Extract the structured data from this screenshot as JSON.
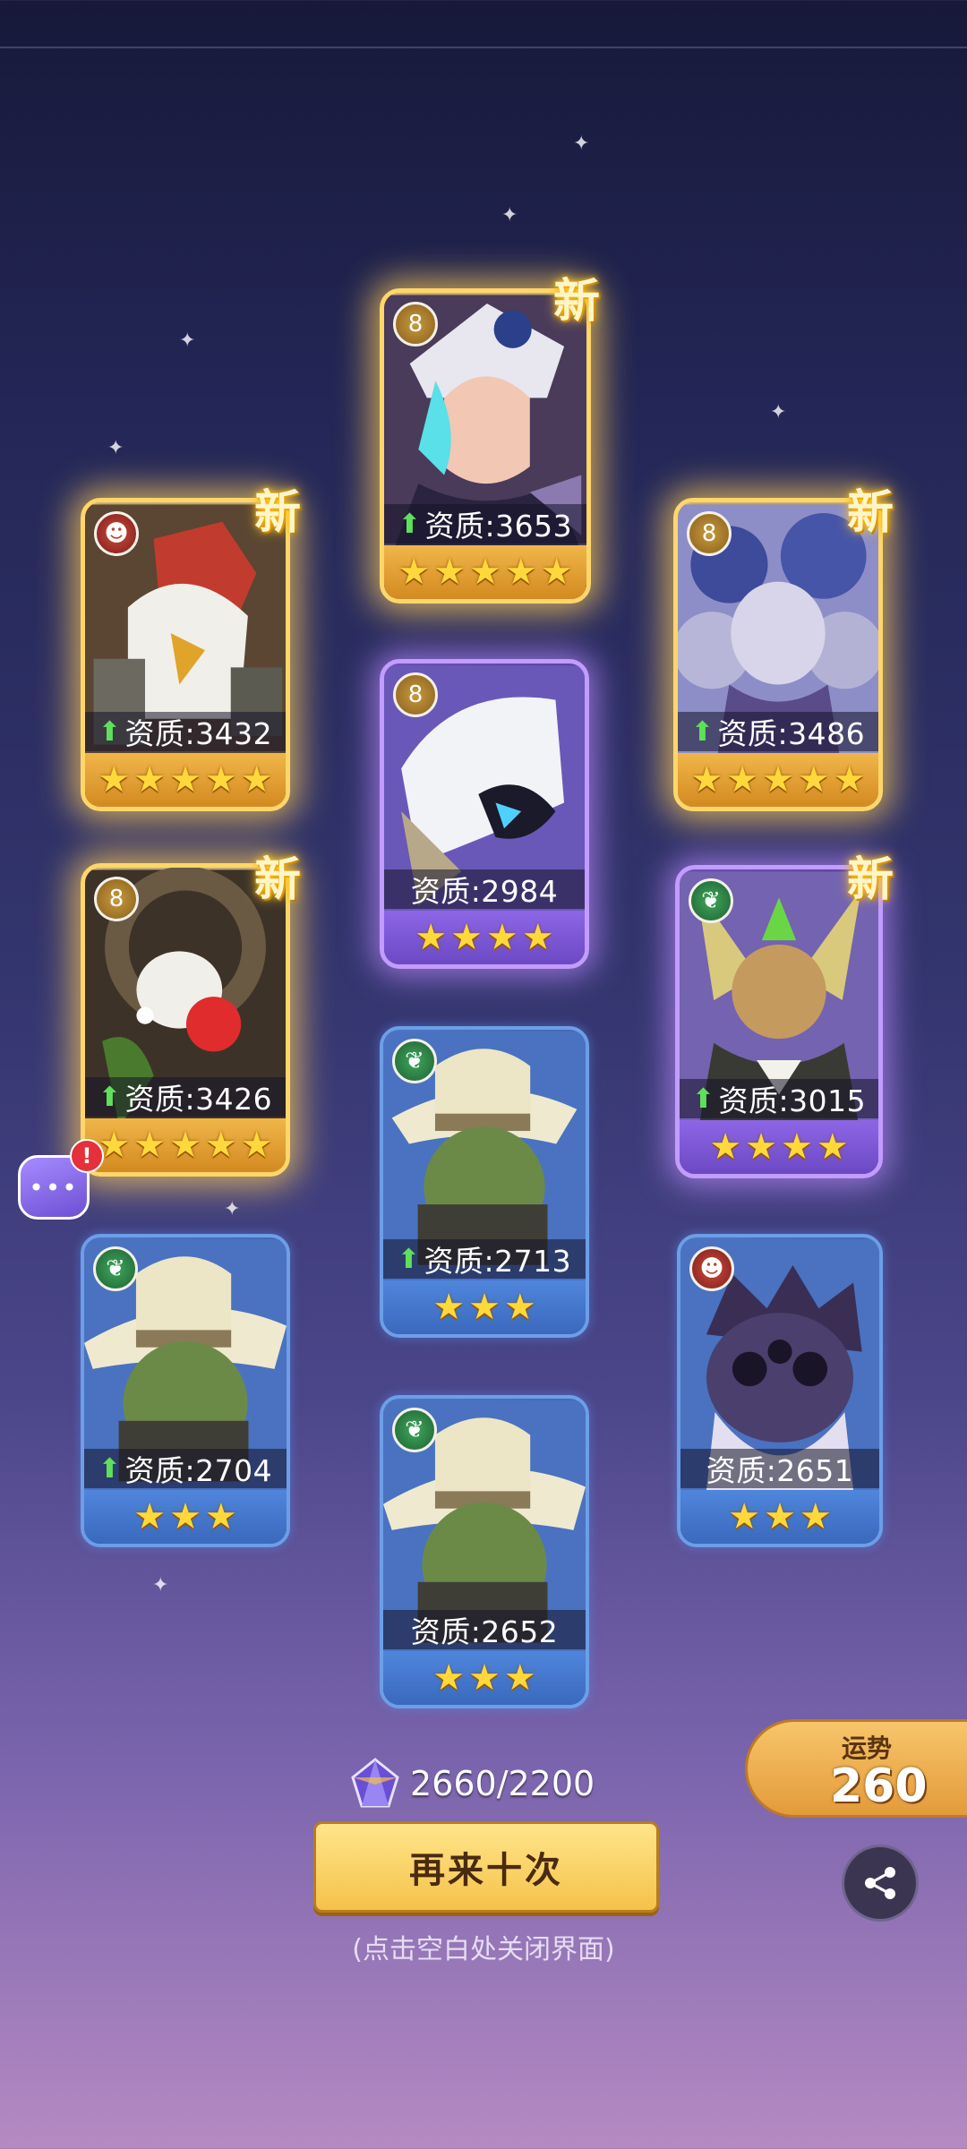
{
  "new_tag": "新",
  "cards": [
    {
      "id": "c1",
      "rarity": "gold",
      "element": "gold",
      "element_icon": "figure-8-icon",
      "stat_label": "资质:3653",
      "upgraded": true,
      "stars": 5,
      "is_new": true
    },
    {
      "id": "c2",
      "rarity": "gold",
      "element": "red",
      "element_icon": "beast-face-icon",
      "stat_label": "资质:3432",
      "upgraded": true,
      "stars": 5,
      "is_new": true
    },
    {
      "id": "c3",
      "rarity": "gold",
      "element": "gold",
      "element_icon": "figure-8-icon",
      "stat_label": "资质:3486",
      "upgraded": true,
      "stars": 5,
      "is_new": true
    },
    {
      "id": "c4",
      "rarity": "purple",
      "element": "gold",
      "element_icon": "figure-8-icon",
      "stat_label": "资质:2984",
      "upgraded": false,
      "stars": 4,
      "is_new": false
    },
    {
      "id": "c5",
      "rarity": "gold",
      "element": "gold",
      "element_icon": "figure-8-icon",
      "stat_label": "资质:3426",
      "upgraded": true,
      "stars": 5,
      "is_new": true
    },
    {
      "id": "c6",
      "rarity": "purple",
      "element": "green",
      "element_icon": "leaf-icon",
      "stat_label": "资质:3015",
      "upgraded": true,
      "stars": 4,
      "is_new": true
    },
    {
      "id": "c7",
      "rarity": "blue",
      "element": "green",
      "element_icon": "leaf-icon",
      "stat_label": "资质:2713",
      "upgraded": true,
      "stars": 3,
      "is_new": false
    },
    {
      "id": "c8",
      "rarity": "blue",
      "element": "green",
      "element_icon": "leaf-icon",
      "stat_label": "资质:2704",
      "upgraded": true,
      "stars": 3,
      "is_new": false
    },
    {
      "id": "c9",
      "rarity": "blue",
      "element": "red",
      "element_icon": "beast-face-icon",
      "stat_label": "资质:2651",
      "upgraded": false,
      "stars": 3,
      "is_new": false
    },
    {
      "id": "c10",
      "rarity": "blue",
      "element": "green",
      "element_icon": "leaf-icon",
      "stat_label": "资质:2652",
      "upgraded": false,
      "stars": 3,
      "is_new": false
    }
  ],
  "currency": {
    "icon": "crystal-icon",
    "amount": "2660/2200"
  },
  "again_button": "再来十次",
  "close_hint": "(点击空白处关闭界面)",
  "fortune": {
    "label": "运势",
    "value": "260"
  },
  "chat": {
    "icon": "chat-bubble-icon",
    "alert": "!"
  },
  "share": {
    "icon": "share-icon"
  },
  "colors": {
    "gold": "#ffd66a",
    "purple": "#c29cff",
    "blue": "#6d9ee8",
    "button": "#f5c24a"
  }
}
